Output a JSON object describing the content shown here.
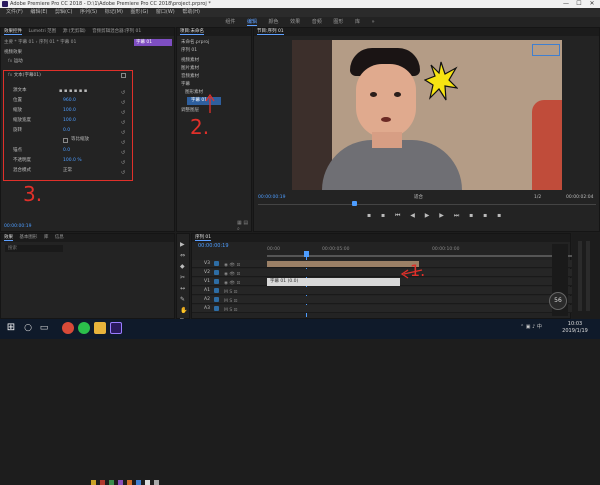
{
  "window": {
    "title": "Adobe Premiere Pro CC 2018 - D:\\1\\Adobe Premiere Pro CC 2018\\project.prproj *",
    "controls": [
      "—",
      "☐",
      "✕"
    ]
  },
  "menu": [
    "文件(F)",
    "编辑(E)",
    "剪辑(C)",
    "序列(S)",
    "标记(M)",
    "图形(G)",
    "窗口(W)",
    "帮助(H)"
  ],
  "workspaces": [
    "组件",
    "编辑",
    "颜色",
    "效果",
    "音频",
    "图形",
    "库",
    "»"
  ],
  "active_workspace": "编辑",
  "effect_controls": {
    "tabs": [
      "效果控件",
      "Lumetri 范围",
      "源:(无剪辑)",
      "音频剪辑混合器:序列 01"
    ],
    "breadcrumb": "主要 * 字幕 01  ›  序列 01 * 字幕 01",
    "clip_label": "字幕 01",
    "section_video": "视频效果",
    "fx_motion": "运动",
    "fx_text": "文本(字幕01)",
    "properties": [
      {
        "label": "源文本",
        "value": ""
      },
      {
        "label": "位置",
        "value": "960.0"
      },
      {
        "label": "缩放",
        "value": "100.0"
      },
      {
        "label": "缩放宽度",
        "value": "100.0"
      },
      {
        "label": "旋转",
        "value": "0.0"
      },
      {
        "label": "锚点",
        "value": "0.0"
      },
      {
        "label": "不透明度",
        "value": "100.0 %"
      },
      {
        "label": "混合模式",
        "value": "正常"
      }
    ],
    "checkbox_label": "等比缩放",
    "timecode": "00:00:00:19"
  },
  "project_panel": {
    "tabs": [
      "项目:未命名",
      "媒体浏览器",
      "库"
    ],
    "items": [
      "未命名.prproj",
      "序列 01",
      "视频素材",
      "图片素材",
      "音频素材",
      "字幕",
      "图形素材",
      "字幕 01",
      "调整图层"
    ],
    "selected_item": "字幕 01"
  },
  "program_monitor": {
    "tab": "节目:序列 01",
    "timecode_left": "00:00:00:19",
    "fit": "适合",
    "quality": "1/2",
    "timecode_right": "00:00:02:04"
  },
  "tools_panel": {
    "tabs": [
      "效果",
      "基本图形",
      "库",
      "信息"
    ],
    "search_placeholder": "搜索"
  },
  "timeline": {
    "tab": "序列 01",
    "timecode": "00:00:00:19",
    "ruler_labels": [
      "00:00",
      "00:00:05:00",
      "00:00:10:00"
    ],
    "tracks": [
      "V3",
      "V2",
      "V1",
      "A1",
      "A2",
      "A3"
    ],
    "clip_label": "字幕 01 (0.0)",
    "audio_level": "56"
  },
  "annotations": [
    "1.",
    "2.",
    "3."
  ],
  "colors": {
    "accent": "#4d9dff",
    "annotation": "#e0302a",
    "panel_bg": "#232323",
    "selection": "#2e5f9e"
  },
  "taskbar": {
    "time": "10:03",
    "date": "2019/1/19",
    "icons": [
      "windows-icon",
      "search-icon",
      "task-view-icon",
      "chrome-icon",
      "wechat-icon",
      "file-explorer-icon",
      "premiere-icon"
    ]
  }
}
